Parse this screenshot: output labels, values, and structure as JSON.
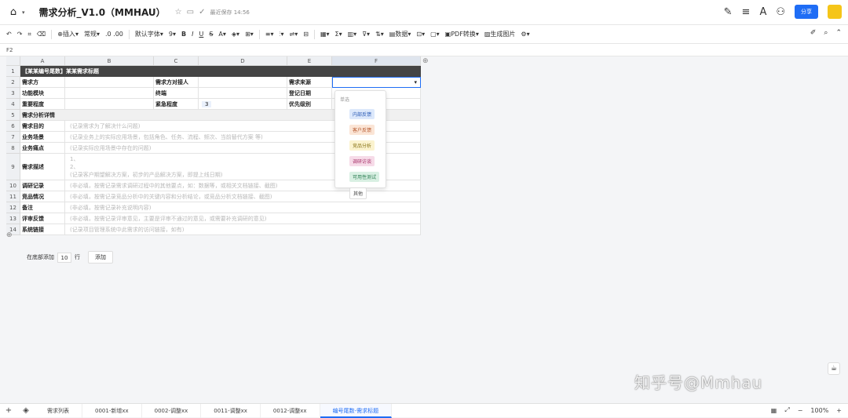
{
  "header": {
    "title": "需求分析_V1.0（MMHAU）",
    "saved": "最近保存 14:56",
    "share": "分享"
  },
  "toolbar": {
    "insert": "插入",
    "format": "常规",
    "font": "默认字体",
    "size": "9",
    "pdf": "PDF转换",
    "image": "生成图片",
    "data": "数据"
  },
  "formula_bar": {
    "cell_ref": "F2"
  },
  "columns": [
    "A",
    "B",
    "C",
    "D",
    "E",
    "F"
  ],
  "sheet": {
    "title_row": "【某某编号尾数】某某需求标题",
    "r2": [
      "需求方",
      "需求方对接人",
      "需求来源"
    ],
    "r3": [
      "功能模块",
      "终端",
      "登记日期"
    ],
    "r4": [
      "重要程度",
      "紧急程度",
      "3",
      "优先级别"
    ],
    "r5": "需求分析详情",
    "details": [
      {
        "row": "6",
        "label": "需求目的",
        "text": "(记录需求为了解决什么问题)"
      },
      {
        "row": "7",
        "label": "业务场景",
        "text": "(记录业务上的实际应用场景，包括角色、任务、流程、频次、当前替代方案 等)"
      },
      {
        "row": "8",
        "label": "业务痛点",
        "text": "(记录实际应用场景中存在的问题)"
      },
      {
        "row": "9",
        "label": "需求描述",
        "text": "(记录客户期望解决方案，初步的产品解决方案，即提上线日期)",
        "extra1": "1、",
        "extra2": "2、"
      },
      {
        "row": "10",
        "label": "调研记录",
        "text": "(非必填，按需记录需求调研过程中的其他要点，如：数据等，或相关文档链接、截图)"
      },
      {
        "row": "11",
        "label": "竞品情况",
        "text": "(非必填，按需记录竞品分析中的关键内容和分析结论，或竞品分析文档链接、截图)"
      },
      {
        "row": "12",
        "label": "备注",
        "text": "(非必填，按需记录补充说明内容)"
      },
      {
        "row": "13",
        "label": "评审反馈",
        "text": "(非必填，按需记录评审意见，主要是评审不通过的意见，或需要补充调研的意见)"
      },
      {
        "row": "14",
        "label": "系统链接",
        "text": "(记录项目管理系统中此需求的访问链接，如有)"
      }
    ]
  },
  "dropdown": {
    "title": "单选",
    "options": [
      {
        "label": "内部反馈",
        "bg": "#dce8fb",
        "fg": "#2b5bb5"
      },
      {
        "label": "客户反馈",
        "bg": "#fbe5d6",
        "fg": "#b5562b"
      },
      {
        "label": "竞品分析",
        "bg": "#fbf3cf",
        "fg": "#8a7417"
      },
      {
        "label": "调研访谈",
        "bg": "#f6dbe8",
        "fg": "#a8346b"
      },
      {
        "label": "可用性测试",
        "bg": "#d9f0e3",
        "fg": "#2b7d52"
      },
      {
        "label": "其他",
        "bg": "#ffffff",
        "fg": "#444444"
      }
    ]
  },
  "add_rows": {
    "prefix": "在底部添加",
    "count": "10",
    "suffix": "行",
    "button": "添加"
  },
  "watermark": "知乎号@Mmhau",
  "tabs": [
    "需求列表",
    "0001-新增xx",
    "0002-调整xx",
    "0011-调整xx",
    "0012-调整xx",
    "编号尾数-需求标题"
  ],
  "zoom": "100%"
}
